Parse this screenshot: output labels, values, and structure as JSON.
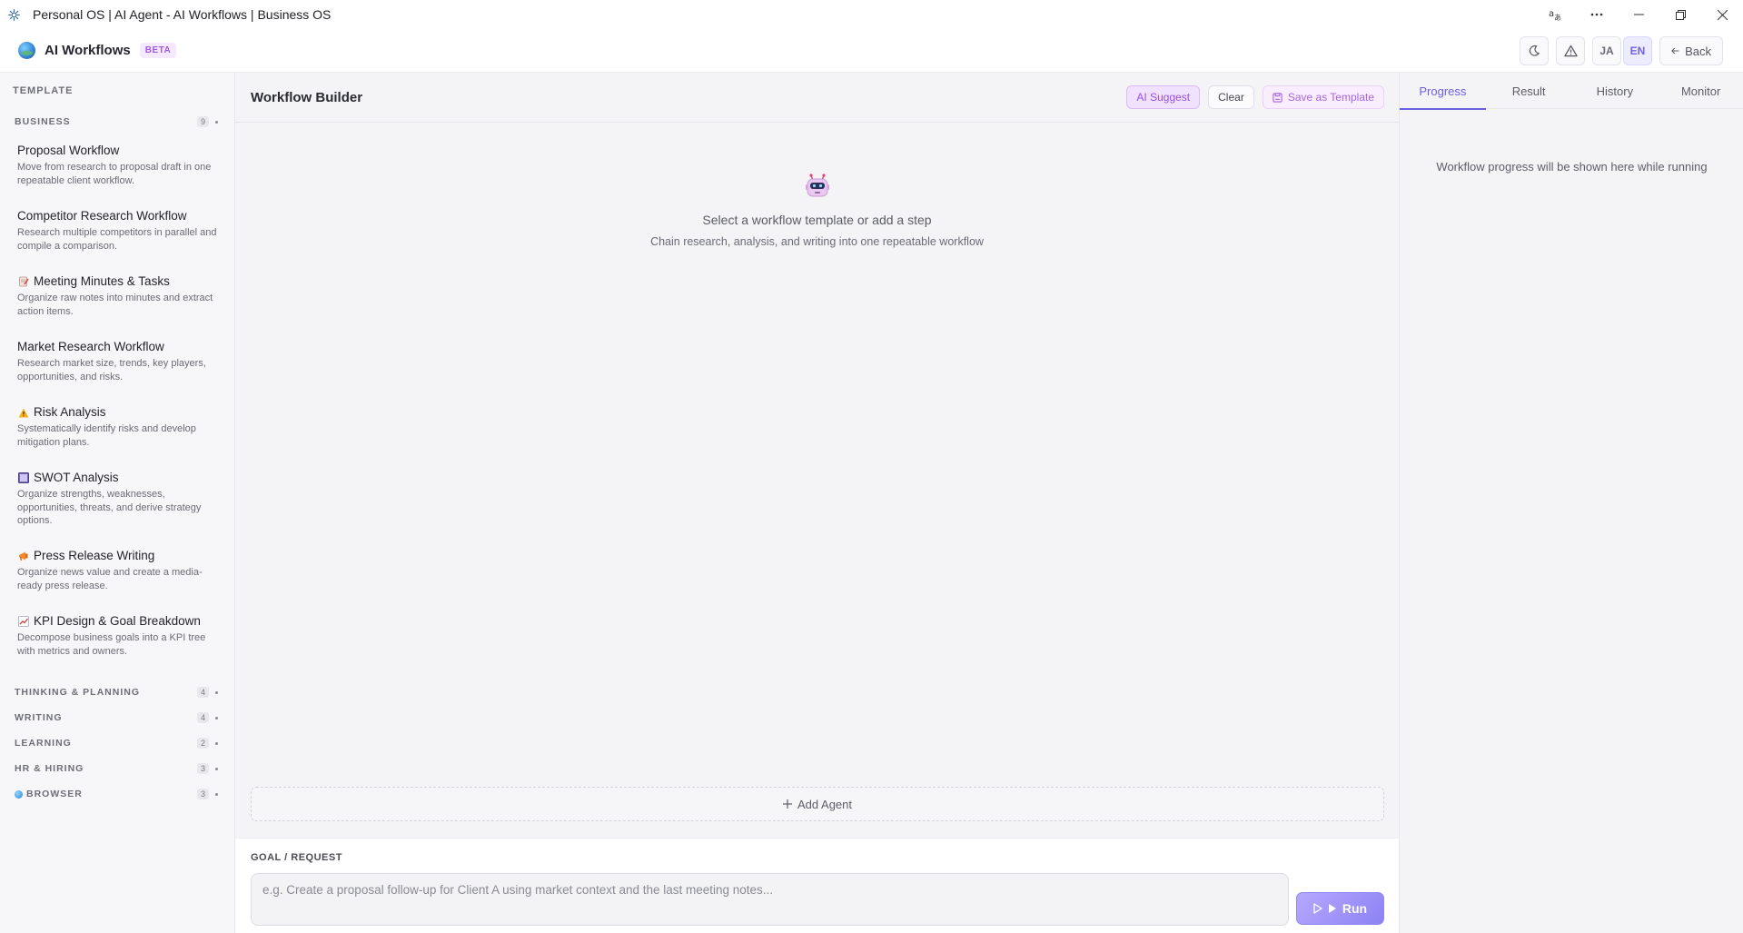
{
  "window": {
    "title": "Personal OS | AI Agent - AI Workflows | Business OS"
  },
  "header": {
    "app_name": "AI Workflows",
    "beta": "BETA",
    "lang_ja": "JA",
    "lang_en": "EN",
    "back": "Back"
  },
  "sidebar": {
    "heading": "TEMPLATE",
    "categories": [
      {
        "label": "BUSINESS",
        "count": "9"
      },
      {
        "label": "THINKING & PLANNING",
        "count": "4"
      },
      {
        "label": "WRITING",
        "count": "4"
      },
      {
        "label": "LEARNING",
        "count": "2"
      },
      {
        "label": "HR & HIRING",
        "count": "3"
      },
      {
        "label": "BROWSER",
        "count": "3"
      }
    ],
    "templates": [
      {
        "title": "Proposal Workflow",
        "desc": "Move from research to proposal draft in one repeatable client workflow.",
        "icon": "none"
      },
      {
        "title": "Competitor Research Workflow",
        "desc": "Research multiple competitors in parallel and compile a comparison.",
        "icon": "none"
      },
      {
        "title": "Meeting Minutes & Tasks",
        "desc": "Organize raw notes into minutes and extract action items.",
        "icon": "memo-icon"
      },
      {
        "title": "Market Research Workflow",
        "desc": "Research market size, trends, key players, opportunities, and risks.",
        "icon": "none"
      },
      {
        "title": "Risk Analysis",
        "desc": "Systematically identify risks and develop mitigation plans.",
        "icon": "warning-icon"
      },
      {
        "title": "SWOT Analysis",
        "desc": "Organize strengths, weaknesses, opportunities, threats, and derive strategy options.",
        "icon": "grid-icon"
      },
      {
        "title": "Press Release Writing",
        "desc": "Organize news value and create a media-ready press release.",
        "icon": "megaphone-icon"
      },
      {
        "title": "KPI Design & Goal Breakdown",
        "desc": "Decompose business goals into a KPI tree with metrics and owners.",
        "icon": "chart-up-icon"
      }
    ]
  },
  "main": {
    "title": "Workflow Builder",
    "ai_suggest": "AI Suggest",
    "clear": "Clear",
    "save_template": "Save as Template",
    "empty_title": "Select a workflow template or add a step",
    "empty_sub": "Chain research, analysis, and writing into one repeatable workflow",
    "add_agent": "Add Agent",
    "goal_label": "GOAL / REQUEST",
    "goal_placeholder": "e.g. Create a proposal follow-up for Client A using market context and the last meeting notes...",
    "goal_value": "",
    "run": "Run"
  },
  "right_panel": {
    "tabs": [
      "Progress",
      "Result",
      "History",
      "Monitor"
    ],
    "active_tab": "Progress",
    "message": "Workflow progress will be shown here while running"
  },
  "colors": {
    "accent": "#6a5fe3",
    "ai_purple": "#9a4fdb",
    "sidebar_bg": "#f7f7f9",
    "main_bg": "#f4f4f7"
  }
}
